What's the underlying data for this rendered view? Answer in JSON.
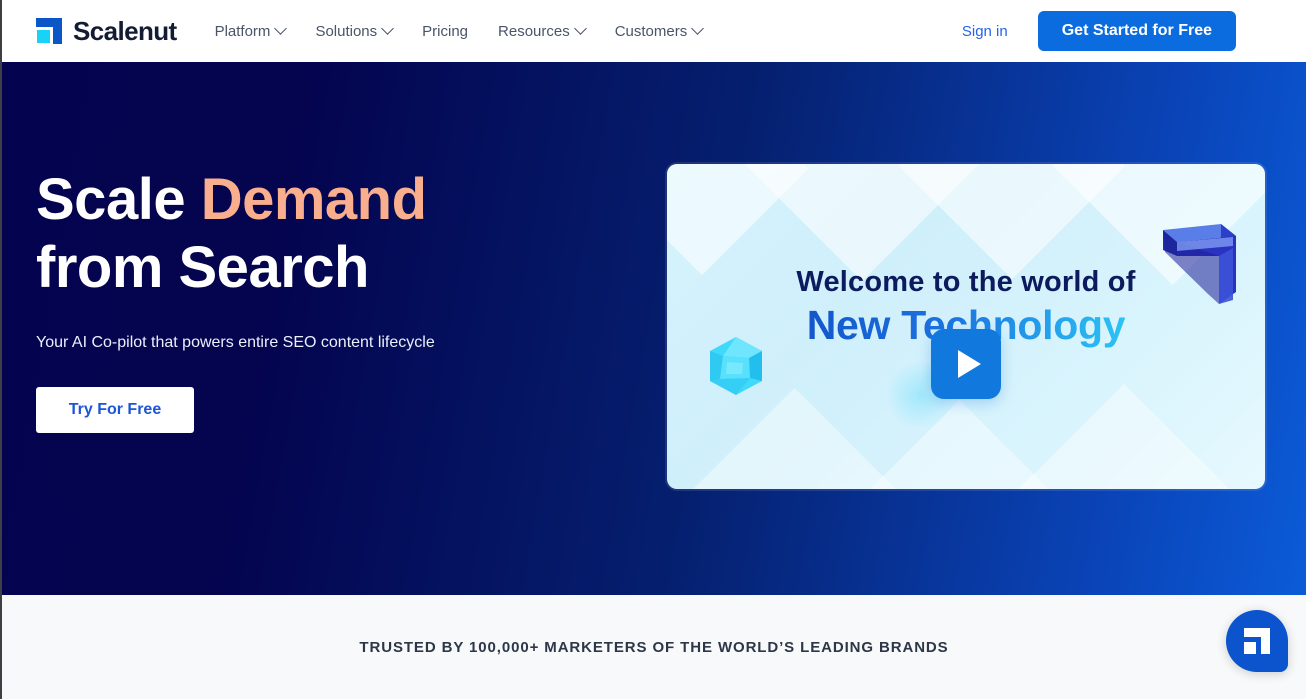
{
  "header": {
    "brand": {
      "name": "Scalenut",
      "logo_icon": "scalenut-logo-icon"
    },
    "nav": [
      {
        "label": "Platform",
        "has_dropdown": true
      },
      {
        "label": "Solutions",
        "has_dropdown": true
      },
      {
        "label": "Pricing",
        "has_dropdown": false
      },
      {
        "label": "Resources",
        "has_dropdown": true
      },
      {
        "label": "Customers",
        "has_dropdown": true
      }
    ],
    "sign_in_label": "Sign in",
    "cta_label": "Get Started for Free"
  },
  "hero": {
    "heading_line1_a": "Scale",
    "heading_line1_b": "Demand",
    "heading_line2": "from Search",
    "subtitle": "Your AI Co-pilot that powers entire SEO content lifecycle",
    "try_button_label": "Try For Free",
    "gradient_start": "#04034F",
    "gradient_end": "#0B5BD8",
    "accent_color": "#F9AE8D"
  },
  "video": {
    "line1": "Welcome to the world of",
    "line2": "New Technology",
    "play_icon": "play-icon",
    "gem_icon": "gem-icon",
    "logo3d_icon": "scalenut-3d-logo-icon",
    "gradient_text_start": "#1356CC",
    "gradient_text_end": "#2BC3F5",
    "play_button_color": "#1178DE"
  },
  "trust_bar": {
    "text": "TRUSTED BY 100,000+ MARKETERS OF THE WORLD’S LEADING BRANDS"
  },
  "chat_widget": {
    "icon": "scalenut-chat-icon",
    "color": "#0B54CE"
  }
}
